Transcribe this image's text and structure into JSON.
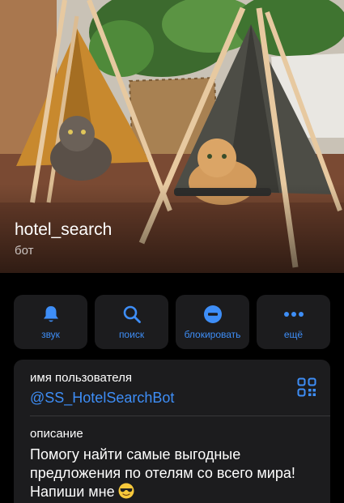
{
  "profile": {
    "name": "hotel_search",
    "subtitle": "бот"
  },
  "actions": [
    {
      "label": "звук",
      "icon": "bell-icon"
    },
    {
      "label": "поиск",
      "icon": "search-icon"
    },
    {
      "label": "блокировать",
      "icon": "block-icon"
    },
    {
      "label": "ещё",
      "icon": "more-icon"
    }
  ],
  "info": {
    "username_label": "имя пользователя",
    "username": "@SS_HotelSearchBot",
    "qr_icon": "qr-code-icon",
    "description_label": "описание",
    "description": "Помогу найти самые выгодные предложения по отелям со всего мира! Напиши мне",
    "description_emoji": "sunglasses-emoji"
  },
  "colors": {
    "accent": "#3e8ef7",
    "card_bg": "#1c1c1e",
    "background": "#000000"
  }
}
